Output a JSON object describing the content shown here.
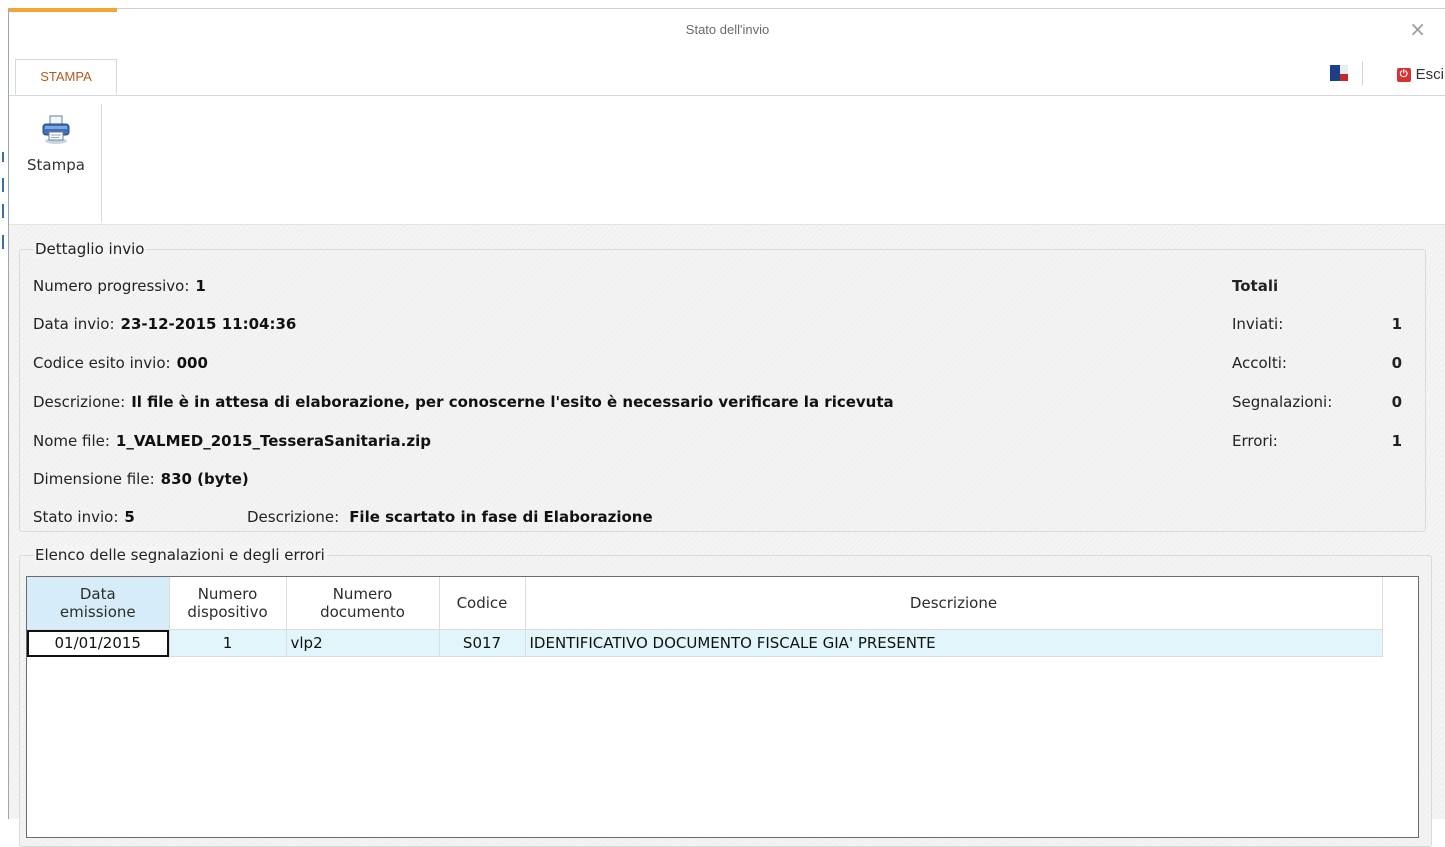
{
  "window": {
    "title": "Stato dell'invio",
    "close_glyph": "×",
    "accent_color": "#f0a535"
  },
  "ribbon": {
    "tab_label": "STAMPA",
    "exit_label": "Esci",
    "print_label": "Stampa",
    "icons": [
      "printer-icon",
      "flag-icon",
      "exit-icon",
      "close-icon"
    ]
  },
  "detail": {
    "legend": "Dettaglio invio",
    "numero_label": "Numero progressivo:",
    "numero_value": "1",
    "data_label": "Data invio:",
    "data_value": "23-12-2015 11:04:36",
    "codice_label": "Codice esito invio:",
    "codice_value": "000",
    "descrizione_label": "Descrizione:",
    "descrizione_value": "Il file è in attesa di elaborazione, per conoscerne l'esito è necessario verificare la ricevuta",
    "nome_label": "Nome file:",
    "nome_value": "1_VALMED_2015_TesseraSanitaria.zip",
    "dim_label": "Dimensione file:",
    "dim_value": "830 (byte)",
    "stato_label": "Stato invio:",
    "stato_value": "5",
    "stato_desc_label": "Descrizione:",
    "stato_desc_value": "File scartato in fase di Elaborazione"
  },
  "totals": {
    "title": "Totali",
    "inviati_label": "Inviati:",
    "inviati_value": "1",
    "accolti_label": "Accolti:",
    "accolti_value": "0",
    "segnalazioni_label": "Segnalazioni:",
    "segnalazioni_value": "0",
    "errori_label": "Errori:",
    "errori_value": "1"
  },
  "errors": {
    "legend": "Elenco delle segnalazioni e degli errori",
    "columns": {
      "data_1": "Data",
      "data_2": "emissione",
      "numdisp_1": "Numero",
      "numdisp_2": "dispositivo",
      "numdoc_1": "Numero",
      "numdoc_2": "documento",
      "codice": "Codice",
      "descrizione": "Descrizione"
    },
    "rows": [
      {
        "data": "01/01/2015",
        "dispositivo": "1",
        "documento": "vlp2",
        "codice": "S017",
        "descrizione": "IDENTIFICATIVO DOCUMENTO FISCALE GIA' PRESENTE"
      }
    ]
  }
}
